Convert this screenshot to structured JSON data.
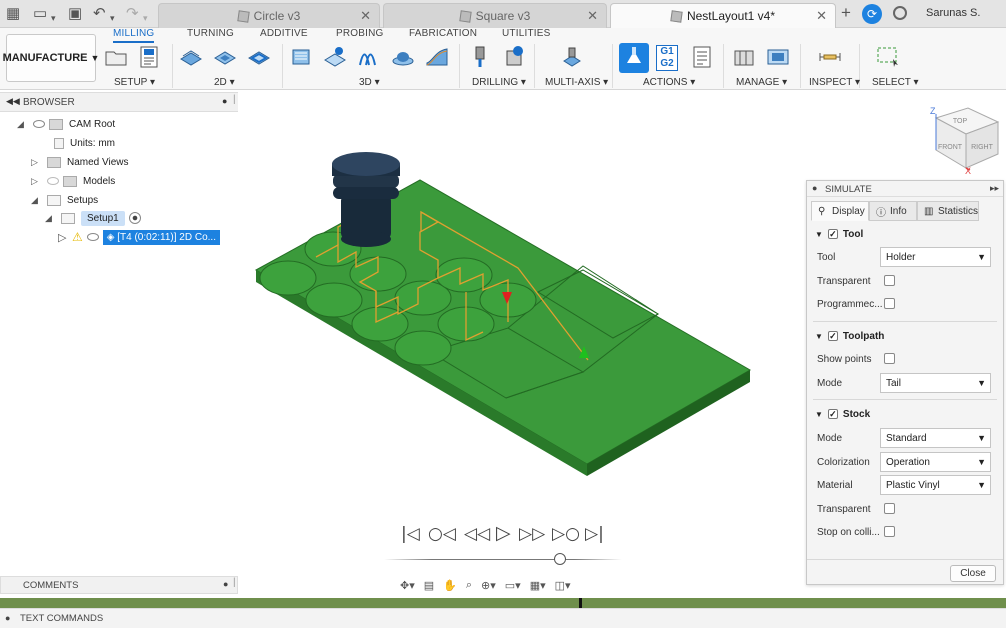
{
  "tabs": [
    {
      "label": "Circle v3"
    },
    {
      "label": "Square v3"
    },
    {
      "label": "NestLayout1 v4*"
    }
  ],
  "user": {
    "name": "Sarunas S."
  },
  "ribbon": {
    "workspace": "MANUFACTURE",
    "tabs": [
      "MILLING",
      "TURNING",
      "ADDITIVE",
      "PROBING",
      "FABRICATION",
      "UTILITIES"
    ],
    "groups": [
      "SETUP",
      "2D",
      "3D",
      "DRILLING",
      "MULTI-AXIS",
      "ACTIONS",
      "MANAGE",
      "INSPECT",
      "SELECT"
    ],
    "g1g2": {
      "l1": "G1",
      "l2": "G2"
    }
  },
  "browser": {
    "title": "BROWSER",
    "items": [
      {
        "label": "CAM Root"
      },
      {
        "label": "Units: mm"
      },
      {
        "label": "Named Views"
      },
      {
        "label": "Models"
      },
      {
        "label": "Setups"
      },
      {
        "label": "Setup1"
      },
      {
        "label": "[T4 (0:02:11)] 2D Co..."
      }
    ]
  },
  "viewcube": {
    "top": "TOP",
    "front": "FRONT",
    "right": "RIGHT",
    "axis_x": "X",
    "axis_z": "Z"
  },
  "simulate": {
    "title": "SIMULATE",
    "tabs": [
      "Display",
      "Info",
      "Statistics"
    ],
    "tool": {
      "section": "Tool",
      "tool_label": "Tool",
      "tool_value": "Holder",
      "transparent": "Transparent",
      "programmed": "Programmec..."
    },
    "toolpath": {
      "section": "Toolpath",
      "show_points": "Show points",
      "mode_label": "Mode",
      "mode_value": "Tail"
    },
    "stock": {
      "section": "Stock",
      "mode_label": "Mode",
      "mode_value": "Standard",
      "colorization_label": "Colorization",
      "colorization_value": "Operation",
      "material_label": "Material",
      "material_value": "Plastic Vinyl",
      "transparent": "Transparent",
      "stop": "Stop on colli..."
    },
    "close": "Close"
  },
  "comments": {
    "label": "COMMENTS"
  },
  "textcmd": {
    "label": "TEXT COMMANDS"
  },
  "colors": {
    "accent": "#1a6ec8",
    "stock": "#3a9a3a",
    "toolpath": "#e0a030",
    "timeline": "#6f8f4c"
  }
}
